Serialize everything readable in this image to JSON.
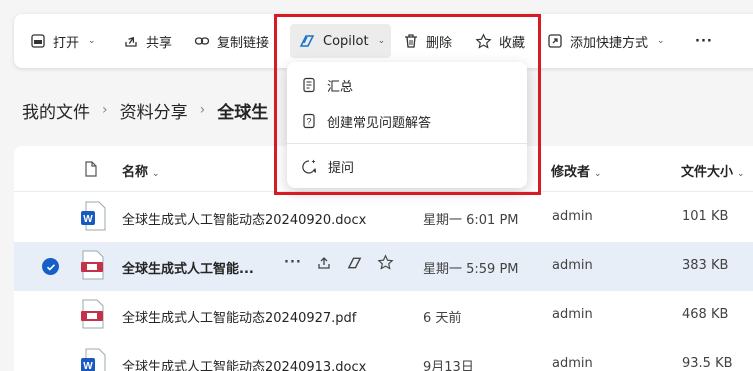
{
  "toolbar": {
    "open": "打开",
    "share": "共享",
    "copy_link": "复制链接",
    "copilot": "Copilot",
    "delete": "删除",
    "favorite": "收藏",
    "add_shortcut": "添加快捷方式",
    "more": "···"
  },
  "copilot_menu": {
    "items": [
      {
        "label": "汇总",
        "icon": "summary-icon"
      },
      {
        "label": "创建常见问题解答",
        "icon": "faq-icon"
      },
      {
        "label": "提问",
        "icon": "ask-icon"
      }
    ]
  },
  "breadcrumb": {
    "items": [
      "我的文件",
      "资料分享",
      "全球生"
    ]
  },
  "columns": {
    "name": "名称",
    "modified_by": "修改者",
    "size": "文件大小"
  },
  "files": [
    {
      "name": "全球生成式人工智能动态20240920.docx",
      "modified": "星期一 6:01 PM",
      "by": "admin",
      "size": "101 KB",
      "type": "word",
      "selected": false
    },
    {
      "name": "全球生成式人工智能...",
      "modified": "星期一 5:59 PM",
      "by": "admin",
      "size": "383 KB",
      "type": "pdf",
      "selected": true
    },
    {
      "name": "全球生成式人工智能动态20240927.pdf",
      "modified": "6 天前",
      "by": "admin",
      "size": "468 KB",
      "type": "pdf",
      "selected": false
    },
    {
      "name": "全球生成式人工智能动态20240913.docx",
      "modified": "9月13日",
      "by": "admin",
      "size": "93.5 KB",
      "type": "word",
      "selected": false
    }
  ],
  "colors": {
    "highlight_border": "#d81b22",
    "selected_row": "#e7eef8",
    "check_blue": "#1460c7",
    "word_blue": "#185abd",
    "pdf_red": "#c4314b"
  }
}
